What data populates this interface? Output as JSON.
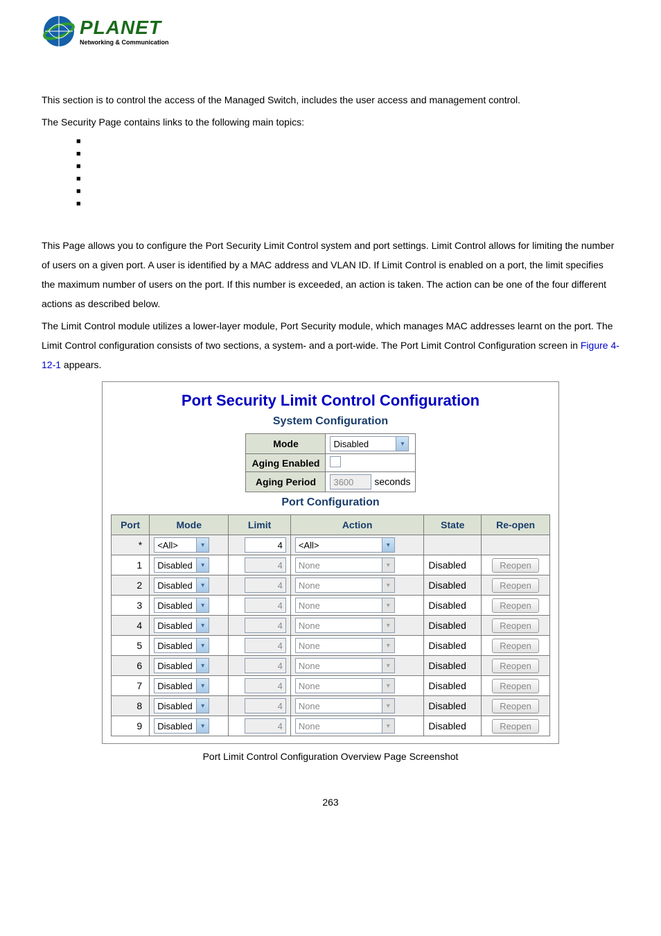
{
  "logo": {
    "main": "PLANET",
    "sub": "Networking & Communication"
  },
  "intro": {
    "p1": "This section is to control the access of the Managed Switch, includes the user access and management control.",
    "p2": "The Security Page contains links to the following main topics:"
  },
  "bullets": [
    "",
    "",
    "",
    "",
    "",
    ""
  ],
  "body": {
    "p1": "This Page allows you to configure the Port Security Limit Control system and port settings. Limit Control allows for limiting the number of users on a given port. A user is identified by a MAC address and VLAN ID. If Limit Control is enabled on a port, the limit specifies the maximum number of users on the port. If this number is exceeded, an action is taken. The action can be one of the four different actions as described below.",
    "p2": "The Limit Control module utilizes a lower-layer module, Port Security module, which manages MAC addresses learnt on the port. The Limit Control configuration consists of two sections, a system- and a port-wide. The Port Limit Control Configuration screen in ",
    "fig_ref": "Figure 4-12-1",
    "p2_tail": " appears."
  },
  "panel": {
    "title": "Port Security Limit Control Configuration",
    "sys_heading": "System Configuration",
    "port_heading": "Port Configuration",
    "sys": {
      "mode_label": "Mode",
      "mode_value": "Disabled",
      "aging_enabled_label": "Aging Enabled",
      "aging_period_label": "Aging Period",
      "aging_period_value": "3600",
      "aging_period_unit": "seconds"
    },
    "headers": {
      "port": "Port",
      "mode": "Mode",
      "limit": "Limit",
      "action": "Action",
      "state": "State",
      "reopen": "Re-open"
    },
    "rows": [
      {
        "port": "*",
        "mode": "<All>",
        "mode_disabled": false,
        "limit": "4",
        "limit_disabled": false,
        "action": "<All>",
        "action_disabled": false,
        "state": "",
        "reopen": "",
        "alt": true
      },
      {
        "port": "1",
        "mode": "Disabled",
        "mode_disabled": false,
        "limit": "4",
        "limit_disabled": true,
        "action": "None",
        "action_disabled": true,
        "state": "Disabled",
        "reopen": "Reopen",
        "alt": false
      },
      {
        "port": "2",
        "mode": "Disabled",
        "mode_disabled": false,
        "limit": "4",
        "limit_disabled": true,
        "action": "None",
        "action_disabled": true,
        "state": "Disabled",
        "reopen": "Reopen",
        "alt": true
      },
      {
        "port": "3",
        "mode": "Disabled",
        "mode_disabled": false,
        "limit": "4",
        "limit_disabled": true,
        "action": "None",
        "action_disabled": true,
        "state": "Disabled",
        "reopen": "Reopen",
        "alt": false
      },
      {
        "port": "4",
        "mode": "Disabled",
        "mode_disabled": false,
        "limit": "4",
        "limit_disabled": true,
        "action": "None",
        "action_disabled": true,
        "state": "Disabled",
        "reopen": "Reopen",
        "alt": true
      },
      {
        "port": "5",
        "mode": "Disabled",
        "mode_disabled": false,
        "limit": "4",
        "limit_disabled": true,
        "action": "None",
        "action_disabled": true,
        "state": "Disabled",
        "reopen": "Reopen",
        "alt": false
      },
      {
        "port": "6",
        "mode": "Disabled",
        "mode_disabled": false,
        "limit": "4",
        "limit_disabled": true,
        "action": "None",
        "action_disabled": true,
        "state": "Disabled",
        "reopen": "Reopen",
        "alt": true
      },
      {
        "port": "7",
        "mode": "Disabled",
        "mode_disabled": false,
        "limit": "4",
        "limit_disabled": true,
        "action": "None",
        "action_disabled": true,
        "state": "Disabled",
        "reopen": "Reopen",
        "alt": false
      },
      {
        "port": "8",
        "mode": "Disabled",
        "mode_disabled": false,
        "limit": "4",
        "limit_disabled": true,
        "action": "None",
        "action_disabled": true,
        "state": "Disabled",
        "reopen": "Reopen",
        "alt": true
      },
      {
        "port": "9",
        "mode": "Disabled",
        "mode_disabled": false,
        "limit": "4",
        "limit_disabled": true,
        "action": "None",
        "action_disabled": true,
        "state": "Disabled",
        "reopen": "Reopen",
        "alt": false
      }
    ]
  },
  "caption": "Port Limit Control Configuration Overview Page Screenshot",
  "page_number": "263"
}
